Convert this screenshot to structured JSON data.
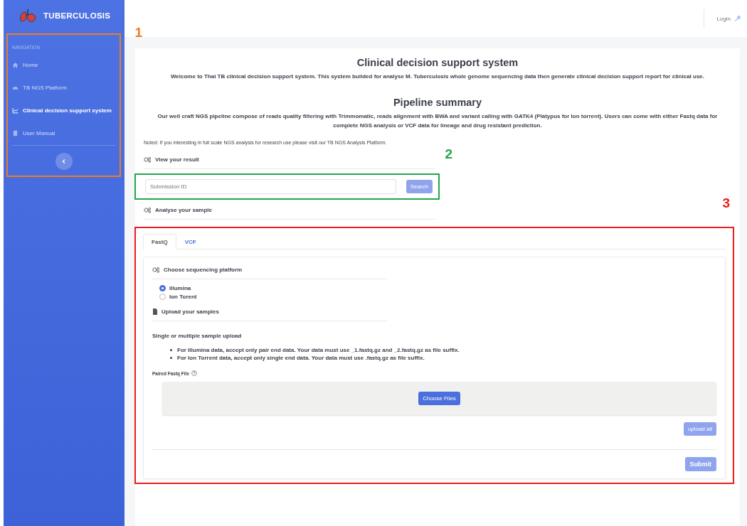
{
  "sidebar": {
    "brand": "TUBERCULOSIS",
    "heading": "NAVIGATION",
    "items": [
      {
        "label": "Home",
        "selected": false
      },
      {
        "label": "TB NGS Platform",
        "selected": false
      },
      {
        "label": "Clinical decision support system",
        "selected": true
      },
      {
        "label": "User Manual",
        "selected": false
      }
    ]
  },
  "header": {
    "login": "Login"
  },
  "main": {
    "title": "Clinical decision support system",
    "welcome": "Welcome to Thai TB clinical decision support system. This system builded for analyse M. Tuberculosis whole genome sequencing data then generate clinical decision support report for clinical use.",
    "summary_title": "Pipeline summary",
    "summary": "Our well craft NGS pipeline compose of reads quality filtering with Trimmomatic, reads alignment with BWA and variant calling with GATK4 (Platypus for Ion torrent). Users can come with either Fastq data for complete NGS analysis or VCF data for lineage and drug resistant prediction.",
    "note": "Noted: If you interesting in full scale NGS analysis for research use please visit our TB NGS Analysis Platform.",
    "view_heading": "View your result",
    "search": {
      "placeholder": "Submission ID",
      "button": "Search"
    },
    "analyse_heading": "Analyse your sample",
    "tabs": [
      {
        "label": "FastQ",
        "selected": true
      },
      {
        "label": "VCF",
        "selected": false
      }
    ],
    "platform_heading": "Choose sequencing platform",
    "platforms": [
      {
        "label": "Illumina",
        "selected": true
      },
      {
        "label": "Ion Torent",
        "selected": false
      }
    ],
    "upload_heading": "Upload your samples",
    "upload_subtitle": "Single or multiple sample upload",
    "rules": [
      "For Illumina data, accept only pair end data. Your data must use _1.fastq.gz and _2.fastq.gz as file suffix.",
      "For Ion Torrent data, accept only single end data. Your data must use .fastq.gz as file suffix."
    ],
    "file_label": "Paired Fastq File",
    "choose_button": "Choose Files",
    "upload_button": "upload all",
    "submit_button": "Submit"
  },
  "callouts": [
    {
      "label": "1",
      "color": "#f07b25"
    },
    {
      "label": "2",
      "color": "#1fa84a"
    },
    {
      "label": "3",
      "color": "#ee1c1c"
    }
  ]
}
